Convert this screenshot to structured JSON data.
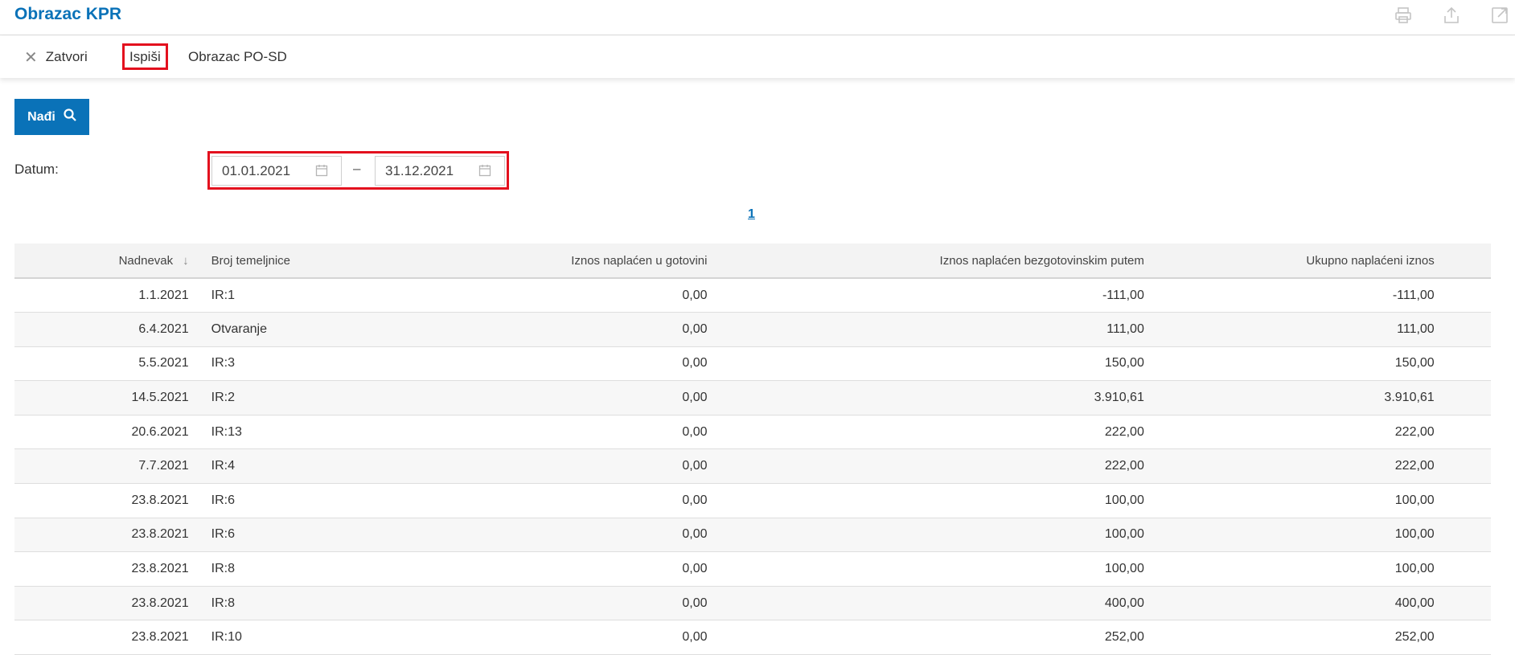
{
  "app": {
    "title": "Obrazac KPR"
  },
  "title_icons": [
    {
      "name": "print-icon"
    },
    {
      "name": "share-icon"
    },
    {
      "name": "open-new-window-icon"
    }
  ],
  "toolbar": {
    "close_label": "Zatvori",
    "print_label": "Ispiši",
    "posd_label": "Obrazac PO-SD"
  },
  "filter": {
    "find_label": "Nađi",
    "date_label": "Datum:",
    "date_from": "01.01.2021",
    "date_to": "31.12.2021",
    "separator": "–"
  },
  "pagination": {
    "current": "1"
  },
  "table": {
    "columns": [
      "Nadnevak",
      "Broj temeljnice",
      "Iznos naplaćen u gotovini",
      "Iznos naplaćen bezgotovinskim putem",
      "Ukupno naplaćeni iznos"
    ],
    "rows": [
      [
        "1.1.2021",
        "IR:1",
        "0,00",
        "-111,00",
        "-111,00"
      ],
      [
        "6.4.2021",
        "Otvaranje",
        "0,00",
        "111,00",
        "111,00"
      ],
      [
        "5.5.2021",
        "IR:3",
        "0,00",
        "150,00",
        "150,00"
      ],
      [
        "14.5.2021",
        "IR:2",
        "0,00",
        "3.910,61",
        "3.910,61"
      ],
      [
        "20.6.2021",
        "IR:13",
        "0,00",
        "222,00",
        "222,00"
      ],
      [
        "7.7.2021",
        "IR:4",
        "0,00",
        "222,00",
        "222,00"
      ],
      [
        "23.8.2021",
        "IR:6",
        "0,00",
        "100,00",
        "100,00"
      ],
      [
        "23.8.2021",
        "IR:6",
        "0,00",
        "100,00",
        "100,00"
      ],
      [
        "23.8.2021",
        "IR:8",
        "0,00",
        "100,00",
        "100,00"
      ],
      [
        "23.8.2021",
        "IR:8",
        "0,00",
        "400,00",
        "400,00"
      ],
      [
        "23.8.2021",
        "IR:10",
        "0,00",
        "252,00",
        "252,00"
      ]
    ]
  },
  "colors": {
    "accent": "#0a72b8",
    "highlight_border": "#e3101e"
  }
}
